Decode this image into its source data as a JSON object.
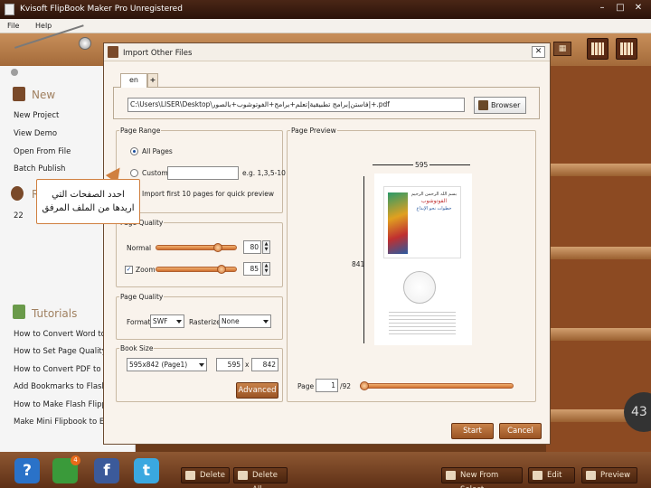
{
  "window": {
    "title": "Kvisoft FlipBook Maker Pro Unregistered",
    "min": "–",
    "max": "□",
    "close": "✕"
  },
  "menu": [
    "File",
    "Help"
  ],
  "left_panel": {
    "new_heading": "New",
    "new_items": [
      "New Project",
      "View Demo",
      "Open From File",
      "Batch Publish"
    ],
    "recent_heading": "R",
    "recent_count": "22",
    "tutorials_heading": "Tutorials",
    "tutorials": [
      "How to Convert Word to H",
      "How to Set Page Quality o",
      "How to Convert PDF to Fla",
      "Add Bookmarks to Flash Pa",
      "How to Make Flash Flipping",
      "Make Mini Flipbook to Embe"
    ]
  },
  "callout": {
    "line1": "احدد الصفحات التي",
    "line2": "اريدها من الملف المرفق"
  },
  "dialog": {
    "title": "Import Other Files",
    "close": "✕",
    "tabs": {
      "active": "en",
      "add": "+"
    },
    "path": "C:\\Users\\LISER\\Desktop\\فاستن|برامج تطبيقية|تعلم+برامج+الفوتوشوب+بالصور|+.pdf",
    "browse_label": "Browser",
    "page_range": {
      "label": "Page Range",
      "all_pages": "All Pages",
      "custom": "Custom",
      "custom_value": "",
      "custom_hint": "e.g. 1,3,5-10",
      "import_first": "Import first 10 pages for quick preview"
    },
    "page_quality": {
      "label": "Page Quality",
      "normal_label": "Normal",
      "normal_value": "80",
      "normal_level": 0.8,
      "zoom_label": "Zoom",
      "zoom_value": "85",
      "zoom_level": 0.85
    },
    "page_quality2": {
      "label": "Page Quality",
      "format_label": "Format",
      "format_value": "SWF",
      "rasterize_label": "Rasterize",
      "rasterize_value": "None"
    },
    "book_size": {
      "label": "Book Size",
      "preset": "595x842 (Page1)",
      "width": "595",
      "x": "x",
      "height": "842",
      "advanced": "Advanced"
    },
    "preview": {
      "label": "Page Preview",
      "width_label": "595",
      "height_label": "841",
      "page_label": "Page",
      "page_value": "1",
      "page_total": "/92",
      "page_level": 0.0,
      "cover_line1": "بسم الله الرحمن الرحيم",
      "cover_line2": "الفوتوشوب",
      "cover_line3": "خطوات نحو الإبداع"
    },
    "start": "Start",
    "cancel": "Cancel"
  },
  "bottom_bar": {
    "help_icon": "?",
    "update_badge": "4",
    "facebook": "f",
    "twitter": "t",
    "delete": "Delete",
    "delete_all": "Delete All",
    "new_from_select": "New From Select",
    "edit": "Edit",
    "preview": "Preview"
  },
  "clock_text": "43",
  "colors": {
    "accent": "#c8824a",
    "wood": "#8c4a22",
    "link_blue": "#1a4c9c"
  }
}
